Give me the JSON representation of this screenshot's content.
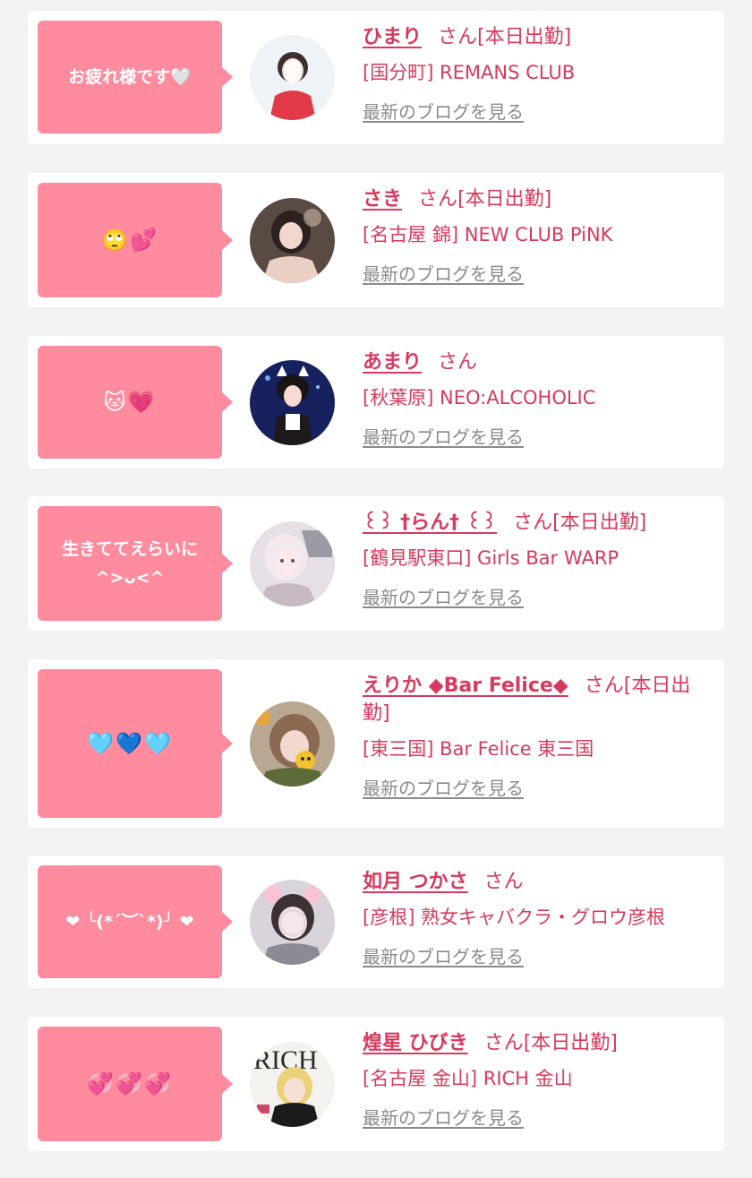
{
  "colors": {
    "accent": "#d63a5e",
    "bubble": "#fe8b9e",
    "link_gray": "#8a8a8a",
    "background": "#f2f2f2"
  },
  "san_suffix": "さん",
  "blog_link_label": "最新のブログを見る",
  "entries": [
    {
      "message": "お疲れ様です🤍",
      "name": "ひまり",
      "status": "[本日出勤]",
      "shop": "[国分町] REMANS CLUB"
    },
    {
      "message": "🙄💕",
      "name": "さき",
      "status": "[本日出勤]",
      "shop": "[名古屋 錦] NEW CLUB PiNK"
    },
    {
      "message": "🐱💗",
      "name": "あまり",
      "status": "",
      "shop": "[秋葉原] NEO:ALCOHOLIC"
    },
    {
      "message": "生きててえらいに ^>ᴗ<^",
      "name": "꒰꒱ †らん† ꒰꒱",
      "status": "[本日出勤]",
      "shop": "[鶴見駅東口] Girls Bar WARP"
    },
    {
      "message": "🩵💙🩵",
      "name": "えりか ◆Bar Felice◆",
      "status": "[本日出勤]",
      "shop": "[東三国] Bar Felice 東三国"
    },
    {
      "message": "❤ ╰(*´︶`*)╯ ❤",
      "name": "如月 つかさ",
      "status": "",
      "shop": "[彦根] 熟女キャバクラ・グロウ彦根"
    },
    {
      "message": "💞💞💞",
      "name": "煌星 ひびき",
      "status": "[本日出勤]",
      "shop": "[名古屋 金山] RICH 金山"
    }
  ]
}
